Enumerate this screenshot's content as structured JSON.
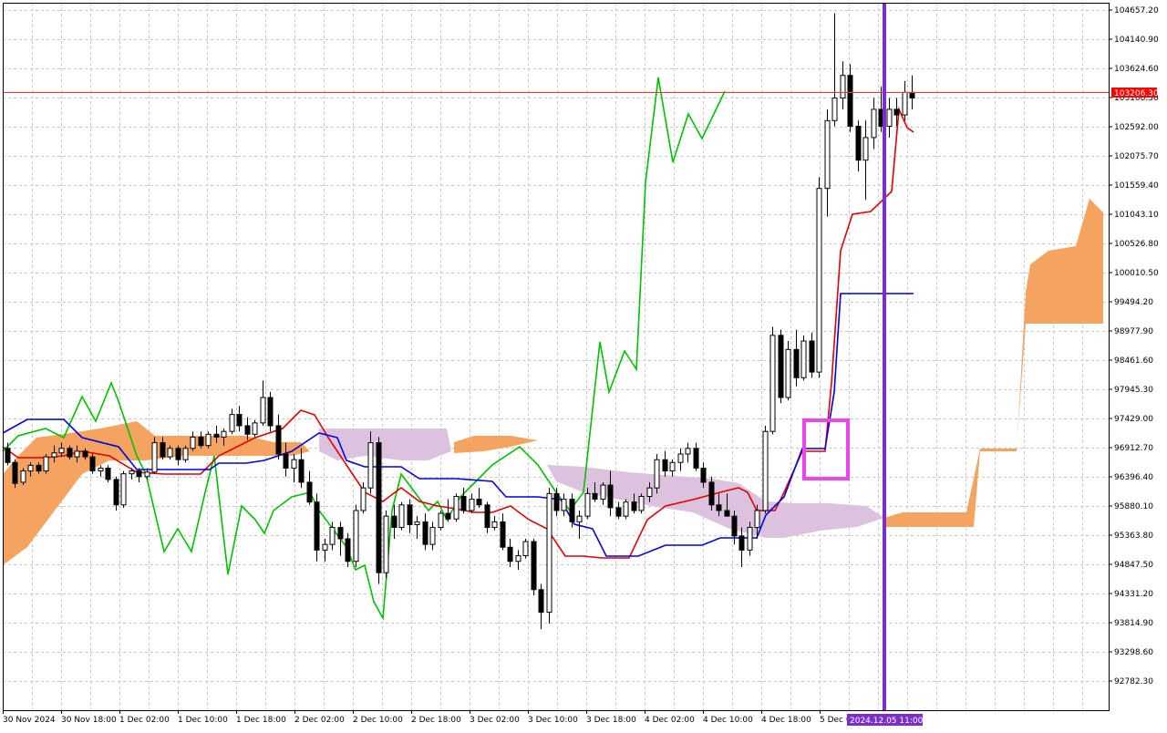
{
  "chart_data": {
    "type": "candlestick",
    "price_labels": [
      "104657.20",
      "104140.90",
      "103624.60",
      "103108.30",
      "102592.00",
      "102075.70",
      "101559.40",
      "101043.10",
      "100526.80",
      "100010.50",
      "99494.20",
      "98977.90",
      "98461.60",
      "97945.30",
      "97429.00",
      "96912.70",
      "96396.40",
      "95880.10",
      "95363.80",
      "94847.50",
      "94331.20",
      "93814.90",
      "93298.60",
      "92782.30"
    ],
    "time_labels": [
      "30 Nov 2024",
      "30 Nov 18:00",
      "1 Dec 02:00",
      "1 Dec 10:00",
      "1 Dec 18:00",
      "2 Dec 02:00",
      "2 Dec 10:00",
      "2 Dec 18:00",
      "3 Dec 02:00",
      "3 Dec 10:00",
      "3 Dec 18:00",
      "4 Dec 02:00",
      "4 Dec 10:00",
      "4 Dec 18:00",
      "5 Dec 0..."
    ],
    "current_price": "103206.30",
    "cursor_time": "2024.12.05 11:00",
    "ylim": [
      92500,
      104900
    ],
    "grid": true,
    "candles": [
      [
        96900,
        97000,
        96600,
        96650
      ],
      [
        96650,
        96700,
        96200,
        96280
      ],
      [
        96300,
        96550,
        96250,
        96500
      ],
      [
        96500,
        96650,
        96400,
        96600
      ],
      [
        96600,
        96650,
        96450,
        96500
      ],
      [
        96500,
        96800,
        96450,
        96750
      ],
      [
        96750,
        96950,
        96650,
        96820
      ],
      [
        96820,
        97000,
        96750,
        96900
      ],
      [
        96900,
        96950,
        96700,
        96750
      ],
      [
        96750,
        96950,
        96650,
        96850
      ],
      [
        96850,
        96900,
        96700,
        96750
      ],
      [
        96750,
        96800,
        96450,
        96500
      ],
      [
        96500,
        96600,
        96400,
        96550
      ],
      [
        96550,
        96600,
        96300,
        96350
      ],
      [
        96350,
        96400,
        95800,
        95900
      ],
      [
        95900,
        96500,
        95850,
        96450
      ],
      [
        96450,
        96550,
        96350,
        96500
      ],
      [
        96500,
        96550,
        96300,
        96400
      ],
      [
        96400,
        96550,
        96350,
        96480
      ],
      [
        96480,
        97100,
        96450,
        97000
      ],
      [
        97000,
        97100,
        96700,
        96750
      ],
      [
        96750,
        96950,
        96700,
        96900
      ],
      [
        96900,
        96950,
        96600,
        96700
      ],
      [
        96700,
        96950,
        96650,
        96900
      ],
      [
        96900,
        97200,
        96850,
        97100
      ],
      [
        97100,
        97200,
        96900,
        96950
      ],
      [
        96950,
        97200,
        96900,
        97150
      ],
      [
        97150,
        97300,
        97000,
        97100
      ],
      [
        97100,
        97250,
        96950,
        97200
      ],
      [
        97200,
        97600,
        97150,
        97500
      ],
      [
        97500,
        97650,
        97200,
        97300
      ],
      [
        97300,
        97450,
        97050,
        97150
      ],
      [
        97150,
        97400,
        97100,
        97350
      ],
      [
        97350,
        98100,
        97300,
        97800
      ],
      [
        97800,
        97900,
        97200,
        97300
      ],
      [
        97300,
        97500,
        96700,
        96800
      ],
      [
        96800,
        97000,
        96400,
        96550
      ],
      [
        96550,
        96800,
        96300,
        96700
      ],
      [
        96700,
        96900,
        96200,
        96300
      ],
      [
        96300,
        96500,
        95900,
        95950
      ],
      [
        95950,
        96100,
        94900,
        95100
      ],
      [
        95100,
        95300,
        94900,
        95200
      ],
      [
        95200,
        95600,
        95100,
        95500
      ],
      [
        95500,
        95600,
        95000,
        95300
      ],
      [
        95300,
        95400,
        94800,
        94900
      ],
      [
        94900,
        95900,
        94800,
        95800
      ],
      [
        95800,
        96300,
        95750,
        96200
      ],
      [
        96200,
        97200,
        96100,
        97000
      ],
      [
        97000,
        97100,
        94500,
        94700
      ],
      [
        94700,
        95800,
        94600,
        95700
      ],
      [
        95700,
        95900,
        95300,
        95500
      ],
      [
        95500,
        95950,
        95450,
        95900
      ],
      [
        95900,
        96000,
        95400,
        95550
      ],
      [
        95550,
        95700,
        95300,
        95600
      ],
      [
        95600,
        95750,
        95100,
        95200
      ],
      [
        95200,
        95600,
        95100,
        95500
      ],
      [
        95500,
        95800,
        95450,
        95750
      ],
      [
        95750,
        96000,
        95600,
        95650
      ],
      [
        95650,
        96100,
        95600,
        96050
      ],
      [
        96050,
        96200,
        95750,
        95800
      ],
      [
        95800,
        96100,
        95750,
        96000
      ],
      [
        96000,
        96200,
        95850,
        95900
      ],
      [
        95900,
        95950,
        95400,
        95500
      ],
      [
        95500,
        95700,
        95450,
        95600
      ],
      [
        95600,
        95750,
        95100,
        95150
      ],
      [
        95150,
        95300,
        94800,
        94900
      ],
      [
        94900,
        95100,
        94750,
        95000
      ],
      [
        95000,
        95300,
        94950,
        95250
      ],
      [
        95250,
        95300,
        94300,
        94400
      ],
      [
        94400,
        94500,
        93700,
        94000
      ],
      [
        94000,
        96200,
        93800,
        96100
      ],
      [
        96100,
        96200,
        95700,
        95800
      ],
      [
        95800,
        96100,
        95700,
        96000
      ],
      [
        96000,
        96100,
        95500,
        95600
      ],
      [
        95600,
        95800,
        95300,
        95700
      ],
      [
        95700,
        96200,
        95650,
        96100
      ],
      [
        96100,
        96300,
        95950,
        96000
      ],
      [
        96000,
        96300,
        95900,
        96250
      ],
      [
        96250,
        96500,
        95700,
        95850
      ],
      [
        95850,
        95950,
        95650,
        95700
      ],
      [
        95700,
        96000,
        95650,
        95950
      ],
      [
        95950,
        96100,
        95750,
        95800
      ],
      [
        95800,
        96100,
        95750,
        96050
      ],
      [
        96050,
        96300,
        95950,
        96200
      ],
      [
        96200,
        96800,
        96100,
        96700
      ],
      [
        96700,
        96850,
        96400,
        96500
      ],
      [
        96500,
        96700,
        96400,
        96650
      ],
      [
        96650,
        96900,
        96500,
        96800
      ],
      [
        96800,
        97000,
        96650,
        96900
      ],
      [
        96900,
        97000,
        96500,
        96550
      ],
      [
        96550,
        96650,
        96200,
        96300
      ],
      [
        96300,
        96400,
        95800,
        95900
      ],
      [
        95900,
        96100,
        95700,
        95800
      ],
      [
        95800,
        96100,
        95700,
        95700
      ],
      [
        95700,
        95800,
        95200,
        95350
      ],
      [
        95350,
        95500,
        94800,
        95100
      ],
      [
        95100,
        95600,
        95000,
        95500
      ],
      [
        95500,
        95900,
        95300,
        95800
      ],
      [
        95800,
        97300,
        95750,
        97200
      ],
      [
        97200,
        99050,
        97150,
        98900
      ],
      [
        98900,
        99000,
        97700,
        97800
      ],
      [
        97800,
        98800,
        97750,
        98650
      ],
      [
        98650,
        99000,
        98000,
        98150
      ],
      [
        98150,
        98900,
        98100,
        98800
      ],
      [
        98800,
        98950,
        98150,
        98250
      ],
      [
        98250,
        101700,
        98150,
        101500
      ],
      [
        101500,
        102900,
        101000,
        102700
      ],
      [
        102700,
        104600,
        102600,
        103100
      ],
      [
        103100,
        103750,
        102900,
        103500
      ],
      [
        103500,
        103700,
        102500,
        102600
      ],
      [
        102600,
        102700,
        101800,
        102000
      ],
      [
        102000,
        102700,
        101300,
        102400
      ],
      [
        102400,
        103100,
        102200,
        102900
      ],
      [
        102900,
        103300,
        102500,
        102600
      ],
      [
        102600,
        103100,
        102400,
        102900
      ],
      [
        102900,
        103100,
        102600,
        102800
      ],
      [
        102800,
        103400,
        102700,
        103200
      ],
      [
        103200,
        103500,
        102900,
        103100
      ]
    ]
  }
}
